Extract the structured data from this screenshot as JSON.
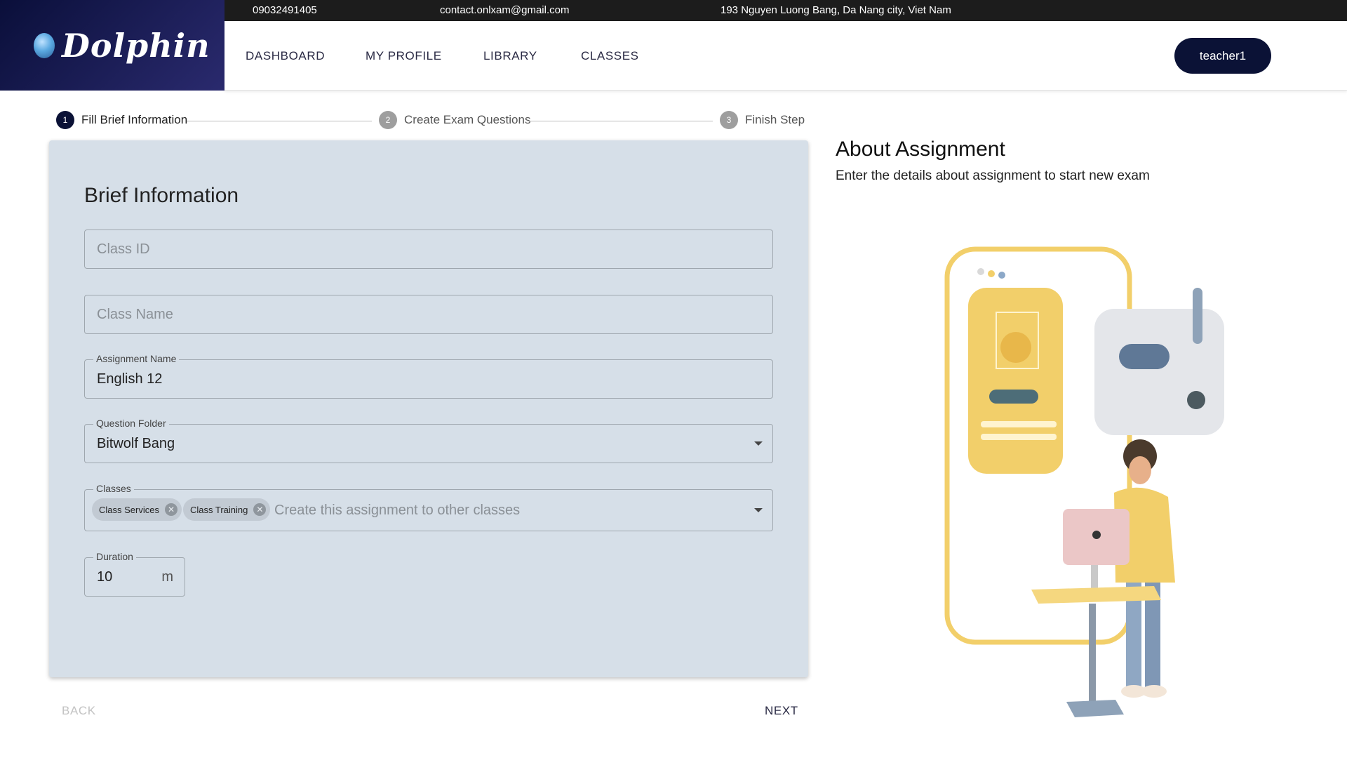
{
  "brand": {
    "name": "Dolphin"
  },
  "topbar": {
    "phone": "09032491405",
    "email": "contact.onlxam@gmail.com",
    "address": "193 Nguyen Luong Bang, Da Nang city, Viet Nam"
  },
  "nav": {
    "items": [
      "DASHBOARD",
      "MY PROFILE",
      "LIBRARY",
      "CLASSES"
    ],
    "user": "teacher1"
  },
  "stepper": {
    "steps": [
      {
        "number": "1",
        "label": "Fill Brief Information",
        "active": true
      },
      {
        "number": "2",
        "label": "Create Exam Questions",
        "active": false
      },
      {
        "number": "3",
        "label": "Finish Step",
        "active": false
      }
    ]
  },
  "form": {
    "title": "Brief Information",
    "class_id": {
      "placeholder": "Class ID",
      "value": ""
    },
    "class_name": {
      "placeholder": "Class Name",
      "value": ""
    },
    "assignment_name": {
      "label": "Assignment Name",
      "value": "English 12"
    },
    "question_folder": {
      "label": "Question Folder",
      "value": "Bitwolf Bang"
    },
    "classes": {
      "label": "Classes",
      "chips": [
        "Class Services",
        "Class Training"
      ],
      "placeholder": "Create this assignment to other classes"
    },
    "duration": {
      "label": "Duration",
      "value": "10",
      "unit": "m"
    }
  },
  "actions": {
    "back": "BACK",
    "next": "NEXT"
  },
  "about": {
    "title": "About Assignment",
    "subtitle": "Enter the details about assignment to start new exam"
  },
  "colors": {
    "brand_dark": "#0b1236",
    "card_bg": "#d6dfe8",
    "topbar_bg": "#1c1c1c",
    "accent_yellow": "#f2cf6a"
  },
  "icons": {
    "logo": "globe-icon",
    "dropdown": "caret-down-icon",
    "chip_remove": "cancel-circle-icon"
  }
}
